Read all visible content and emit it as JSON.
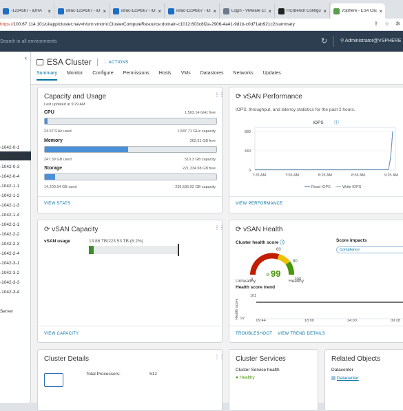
{
  "browser": {
    "tabs": [
      {
        "title": "-1234567 - iDRA",
        "fav": "#1c6fc2"
      },
      {
        "title": "idrac-1234567 - iDR",
        "fav": "#1c6fc2"
      },
      {
        "title": "idrac-1234567 - iDR",
        "fav": "#1c6fc2"
      },
      {
        "title": "idrac-1234567 - iDR",
        "fav": "#1c6fc2"
      },
      {
        "title": "Login - VMware ES",
        "fav": "#6b7b8c"
      },
      {
        "title": "HCIBench Configu",
        "fav": "#222222"
      },
      {
        "title": "vSphere - ESA Clust",
        "fav": "#5aa04a"
      }
    ],
    "url_scheme": "https://",
    "url_rest": "100.67.114.101/ui/app/cluster;nav=h/urn:vmomi:ClusterComputeResource:domain-c1012:603c8f2a-2906-4a41-9d1b-c0d71ab921c2/summary"
  },
  "header": {
    "search_placeholder": "Search in all environments",
    "user": "Administrator@VSPHERE"
  },
  "sidebar": {
    "items": [
      {
        "label": "-1042-0-1",
        "top": 136
      },
      {
        "label": "-1042-0-2",
        "top": 150
      },
      {
        "label": "-1042-0-3",
        "top": 164
      },
      {
        "label": "-1042-0-4",
        "top": 178
      },
      {
        "label": "-1042-1-1",
        "top": 192
      },
      {
        "label": "-1042-1-2",
        "top": 206
      },
      {
        "label": "-1042-1-3",
        "top": 220
      },
      {
        "label": "-1042-1-4",
        "top": 234
      },
      {
        "label": "-1042-2-1",
        "top": 248
      },
      {
        "label": "-1042-2-2",
        "top": 262
      },
      {
        "label": "-1042-2-3",
        "top": 276
      },
      {
        "label": "-1042-2-4",
        "top": 290
      },
      {
        "label": "-1042-3-1",
        "top": 304
      },
      {
        "label": "-1042-3-2",
        "top": 318
      },
      {
        "label": "-1042-3-3",
        "top": 332
      },
      {
        "label": "-1042-3-4",
        "top": 346
      },
      {
        "label": "Server",
        "top": 374
      }
    ]
  },
  "object": {
    "title": "ESA Cluster",
    "actions": "ACTIONS",
    "tabs": [
      "Summary",
      "Monitor",
      "Configure",
      "Permissions",
      "Hosts",
      "VMs",
      "Datastores",
      "Networks",
      "Updates"
    ]
  },
  "capacity": {
    "title": "Capacity and Usage",
    "updated": "Last updated at 9:29 AM",
    "cpu": {
      "label": "CPU",
      "free": "1,563.14 GHz free",
      "used": "24.57 GHz used",
      "cap": "1,587.71 GHz capacity",
      "pct": 0.0155
    },
    "memory": {
      "label": "Memory",
      "free": "262.91 GB free",
      "used": "247.39 GB used",
      "cap": "510.3 GB capacity",
      "pct": 0.485
    },
    "storage": {
      "label": "Storage",
      "free": "221,334.98 GB free",
      "used": "14,200.94 GB used",
      "cap": "235,535.92 GB capacity",
      "pct": 0.06
    },
    "link": "VIEW STATS"
  },
  "perf": {
    "title": "vSAN Performance",
    "desc": "IOPS, throughput, and latency statistics for the past 2 hours.",
    "link": "VIEW PERFORMANCE",
    "chart_data": {
      "type": "line",
      "title": "IOPS",
      "y_ticks": [
        "880",
        "440",
        "0"
      ],
      "ylim": [
        0,
        880
      ],
      "categories": [
        "7:25 AM",
        "7:55 AM",
        "8:25 AM",
        "8:55 AM",
        "9:25 AM"
      ],
      "series": [
        {
          "name": "Read IOPS",
          "color": "#2f6fb3",
          "x": [
            0,
            0.05,
            0.1,
            0.15,
            0.2,
            0.25,
            0.3,
            0.35,
            0.4,
            0.45,
            0.5,
            0.55,
            0.6,
            0.65,
            0.7,
            0.75,
            0.8,
            0.85,
            0.9,
            0.95,
            0.97,
            0.985,
            1.0
          ],
          "values": [
            10,
            10,
            10,
            10,
            10,
            10,
            10,
            10,
            10,
            10,
            10,
            10,
            10,
            10,
            10,
            10,
            10,
            10,
            10,
            10,
            12,
            300,
            880
          ]
        },
        {
          "name": "Write IOPS",
          "color": "#7f9fc3",
          "x": [
            0,
            0.5,
            0.97,
            0.985,
            1.0
          ],
          "values": [
            5,
            5,
            6,
            260,
            820
          ]
        }
      ]
    }
  },
  "vsancap": {
    "title": "vSAN Capacity",
    "usage_label": "vSAN usage",
    "usage_value": "13.86 TB/223.53 TB (6.2%)",
    "pct": 0.062,
    "link": "VIEW CAPACITY"
  },
  "health": {
    "title": "vSAN Health",
    "score_label": "Cluster health score",
    "score": "99",
    "gauge": {
      "t0": "0",
      "t60": "60",
      "t80": "80",
      "t100": "100",
      "low": "Unhealthy",
      "high": "Healthy"
    },
    "impacts_label": "Score impacts",
    "impact": "Compliance",
    "trend_title": "Health score trend",
    "trend_axis": "Health score",
    "trend_y": [
      "101",
      "97"
    ],
    "trend_x": [
      [
        "11/08,",
        "09:44"
      ],
      [
        "11/08,",
        "18:00"
      ],
      [
        "11/09,",
        "24:00"
      ],
      [
        "11/09,",
        "09:28"
      ]
    ],
    "link1": "TROUBLESHOOT",
    "link2": "VIEW TREND DETAILS"
  },
  "details": {
    "title": "Cluster Details",
    "proc_label": "Total Processors:",
    "proc_value": "512"
  },
  "services": {
    "title": "Cluster Services",
    "health_label": "Cluster Service health",
    "status": "Healthy"
  },
  "related": {
    "title": "Related Objects",
    "dc_label": "Datacenter",
    "dc_value": "Datacenter"
  }
}
